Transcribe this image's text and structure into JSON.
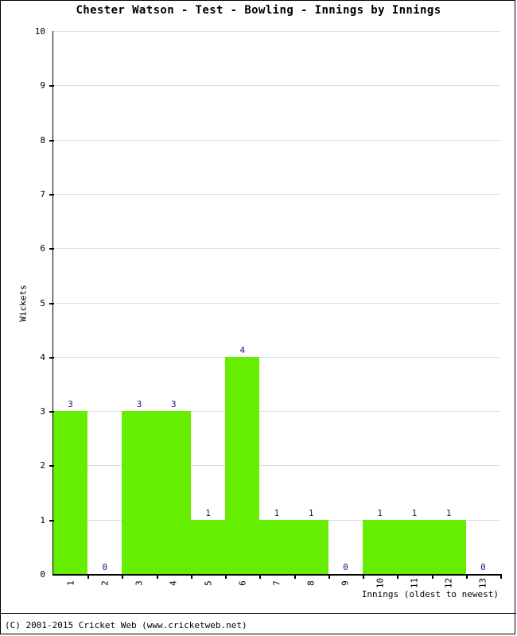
{
  "page": {
    "background_color": "#ffffff",
    "border_color": "#000000"
  },
  "footer": {
    "text": "(C) 2001-2015 Cricket Web (www.cricketweb.net)"
  },
  "chart_data": {
    "type": "bar",
    "title": "Chester Watson - Test - Bowling - Innings by Innings",
    "xlabel": "Innings (oldest to newest)",
    "ylabel": "Wickets",
    "categories": [
      "1",
      "2",
      "3",
      "4",
      "5",
      "6",
      "7",
      "8",
      "9",
      "10",
      "11",
      "12",
      "13"
    ],
    "values": [
      3,
      0,
      3,
      3,
      1,
      4,
      1,
      1,
      0,
      1,
      1,
      1,
      0
    ],
    "data_labels": [
      "3",
      "0",
      "3",
      "3",
      "1",
      "4",
      "1",
      "1",
      "0",
      "1",
      "1",
      "1",
      "0"
    ],
    "ylim": [
      0,
      10
    ],
    "yticks": [
      0,
      1,
      2,
      3,
      4,
      5,
      6,
      7,
      8,
      9,
      10
    ],
    "ytick_labels": [
      "0",
      "1",
      "2",
      "3",
      "4",
      "5",
      "6",
      "7",
      "8",
      "9",
      "10"
    ],
    "grid": true,
    "legend": false,
    "bar_color": "#66ee00",
    "data_label_color": "#191970",
    "gridline_color": "#dddddd",
    "axis_color": "#000000"
  }
}
